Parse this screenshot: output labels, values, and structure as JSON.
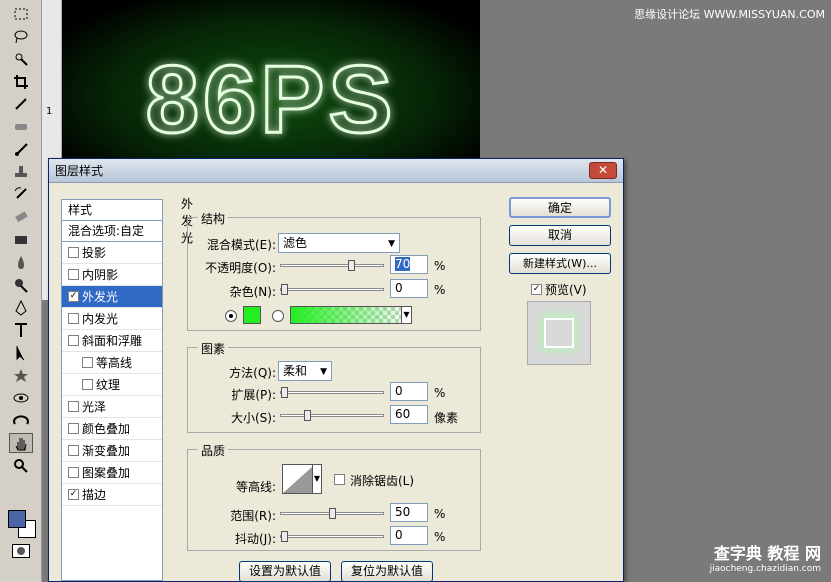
{
  "canvas": {
    "text": "86PS",
    "ruler_mark": "1"
  },
  "watermarks": {
    "top": "思缘设计论坛 WWW.MISSYUAN.COM",
    "bottom_main": "查字典 教程 网",
    "bottom_url": "jiaocheng.chazidian.com"
  },
  "toolbar": {
    "tools": [
      "marquee-icon",
      "lasso-icon",
      "quick-select-icon",
      "crop-icon",
      "eyedropper-icon",
      "healing-icon",
      "brush-icon",
      "stamp-icon",
      "history-brush-icon",
      "eraser-icon",
      "gradient-icon",
      "blur-icon",
      "dodge-icon",
      "pen-icon",
      "type-icon",
      "path-select-icon",
      "shape-icon",
      "3d-rotate-icon",
      "3d-orbit-icon",
      "hand-icon",
      "zoom-icon"
    ],
    "fg_color": "#4a66a6",
    "bg_color": "#ffffff"
  },
  "dialog": {
    "title": "图层样式",
    "close": "✕",
    "sidebar": {
      "header": "样式",
      "blend_options": "混合选项:自定",
      "items": [
        {
          "label": "投影",
          "checked": false,
          "sub": false
        },
        {
          "label": "内阴影",
          "checked": false,
          "sub": false
        },
        {
          "label": "外发光",
          "checked": true,
          "sub": false,
          "selected": true
        },
        {
          "label": "内发光",
          "checked": false,
          "sub": false
        },
        {
          "label": "斜面和浮雕",
          "checked": false,
          "sub": false
        },
        {
          "label": "等高线",
          "checked": false,
          "sub": true
        },
        {
          "label": "纹理",
          "checked": false,
          "sub": true
        },
        {
          "label": "光泽",
          "checked": false,
          "sub": false
        },
        {
          "label": "颜色叠加",
          "checked": false,
          "sub": false
        },
        {
          "label": "渐变叠加",
          "checked": false,
          "sub": false
        },
        {
          "label": "图案叠加",
          "checked": false,
          "sub": false
        },
        {
          "label": "描边",
          "checked": true,
          "sub": false
        }
      ]
    },
    "panel_title": "外发光",
    "structure": {
      "title": "结构",
      "blend_mode_label": "混合模式(E):",
      "blend_mode": "滤色",
      "opacity_label": "不透明度(O):",
      "opacity": "70",
      "opacity_unit": "%",
      "noise_label": "杂色(N):",
      "noise": "0",
      "noise_unit": "%",
      "glow_color": "#22ee22"
    },
    "elements": {
      "title": "图素",
      "method_label": "方法(Q):",
      "method": "柔和",
      "spread_label": "扩展(P):",
      "spread": "0",
      "spread_unit": "%",
      "size_label": "大小(S):",
      "size": "60",
      "size_unit": "像素"
    },
    "quality": {
      "title": "品质",
      "contour_label": "等高线:",
      "antialias_label": "消除锯齿(L)",
      "range_label": "范围(R):",
      "range": "50",
      "range_unit": "%",
      "jitter_label": "抖动(J):",
      "jitter": "0",
      "jitter_unit": "%"
    },
    "buttons": {
      "set_default": "设置为默认值",
      "reset_default": "复位为默认值",
      "ok": "确定",
      "cancel": "取消",
      "new_style": "新建样式(W)...",
      "preview": "预览(V)"
    },
    "slider_levels": {
      "opacity": 0.7,
      "noise": 0,
      "spread": 0,
      "size": 0.24,
      "range": 0.5,
      "jitter": 0
    }
  }
}
